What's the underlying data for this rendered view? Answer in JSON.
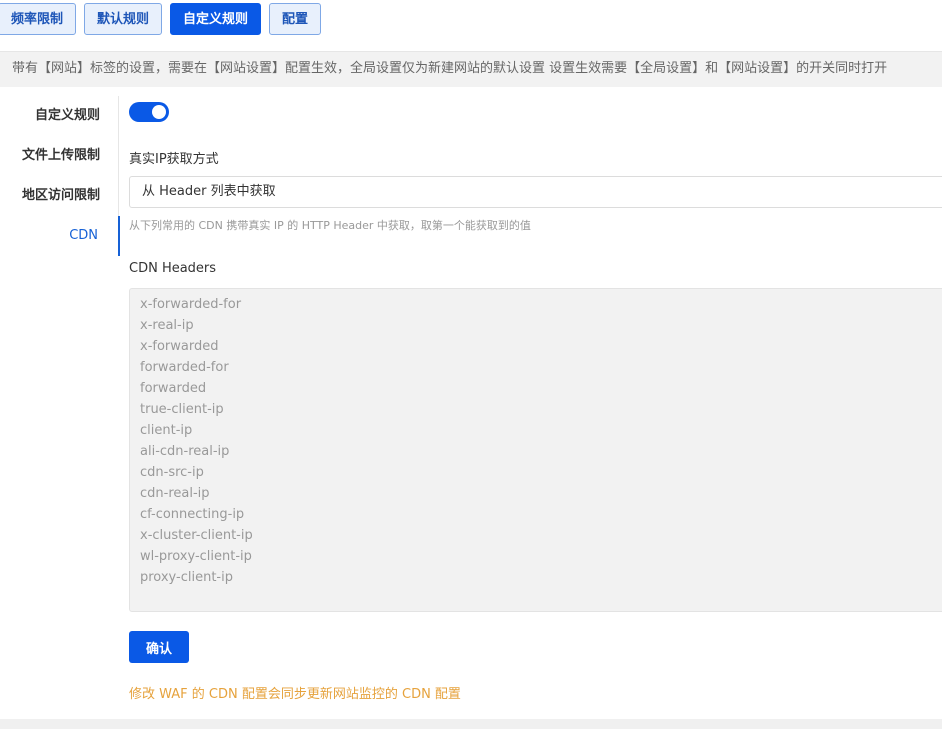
{
  "tabs": [
    {
      "label": "频率限制",
      "active": false
    },
    {
      "label": "默认规则",
      "active": false
    },
    {
      "label": "自定义规则",
      "active": true
    },
    {
      "label": "配置",
      "active": false
    }
  ],
  "notice": "带有【网站】标签的设置，需要在【网站设置】配置生效，全局设置仅为新建网站的默认设置 设置生效需要【全局设置】和【网站设置】的开关同时打开",
  "sidebar": {
    "items": [
      {
        "label": "自定义规则",
        "active": false
      },
      {
        "label": "文件上传限制",
        "active": false
      },
      {
        "label": "地区访问限制",
        "active": false
      },
      {
        "label": "CDN",
        "active": true
      }
    ]
  },
  "main": {
    "toggle_on": true,
    "ip_method_label": "真实IP获取方式",
    "ip_method_value": "从 Header 列表中获取",
    "ip_method_help": "从下列常用的 CDN 携带真实 IP 的 HTTP Header 中获取，取第一个能获取到的值",
    "headers_label": "CDN Headers",
    "headers": [
      "x-forwarded-for",
      "x-real-ip",
      "x-forwarded",
      "forwarded-for",
      "forwarded",
      "true-client-ip",
      "client-ip",
      "ali-cdn-real-ip",
      "cdn-src-ip",
      "cdn-real-ip",
      "cf-connecting-ip",
      "x-cluster-client-ip",
      "wl-proxy-client-ip",
      "proxy-client-ip"
    ],
    "confirm_label": "确认",
    "warning": "修改 WAF 的 CDN 配置会同步更新网站监控的 CDN 配置"
  },
  "colors": {
    "primary": "#0a59e6",
    "warning": "#e6a23c"
  }
}
